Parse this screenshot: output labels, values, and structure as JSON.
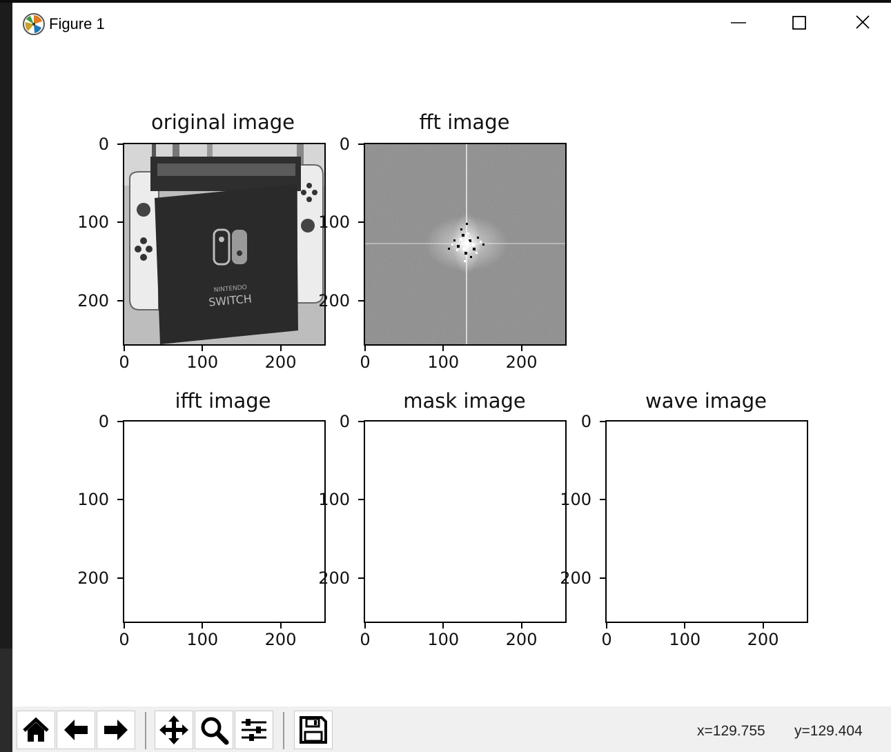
{
  "window": {
    "title": "Figure 1",
    "icons": {
      "app": "matplotlib-icon",
      "minimize": "minimize-icon",
      "maximize": "maximize-icon",
      "close": "close-icon"
    }
  },
  "chart_data": [
    {
      "type": "image",
      "title": "original image",
      "content": "photo of a Nintendo Switch box with joy-cons",
      "xticks": [
        "0",
        "100",
        "200"
      ],
      "yticks": [
        "0",
        "100",
        "200"
      ],
      "xlim": [
        0,
        256
      ],
      "ylim": [
        256,
        0
      ]
    },
    {
      "type": "image",
      "title": "fft image",
      "content": "FFT magnitude spectrum",
      "xticks": [
        "0",
        "100",
        "200"
      ],
      "yticks": [
        "0",
        "100",
        "200"
      ],
      "xlim": [
        0,
        256
      ],
      "ylim": [
        256,
        0
      ]
    },
    {
      "type": "image",
      "title": "ifft image",
      "content": "empty",
      "xticks": [
        "0",
        "100",
        "200"
      ],
      "yticks": [
        "0",
        "100",
        "200"
      ],
      "xlim": [
        0,
        256
      ],
      "ylim": [
        256,
        0
      ]
    },
    {
      "type": "image",
      "title": "mask image",
      "content": "empty",
      "xticks": [
        "0",
        "100",
        "200"
      ],
      "yticks": [
        "0",
        "100",
        "200"
      ],
      "xlim": [
        0,
        256
      ],
      "ylim": [
        256,
        0
      ]
    },
    {
      "type": "image",
      "title": "wave image",
      "content": "empty",
      "xticks": [
        "0",
        "100",
        "200"
      ],
      "yticks": [
        "0",
        "100",
        "200"
      ],
      "xlim": [
        0,
        256
      ],
      "ylim": [
        256,
        0
      ]
    }
  ],
  "toolbar": {
    "buttons": [
      "home-icon",
      "back-icon",
      "forward-icon",
      "pan-icon",
      "zoom-icon",
      "configure-subplots-icon",
      "save-icon"
    ],
    "coord_x": "x=129.755",
    "coord_y": "y=129.404"
  }
}
